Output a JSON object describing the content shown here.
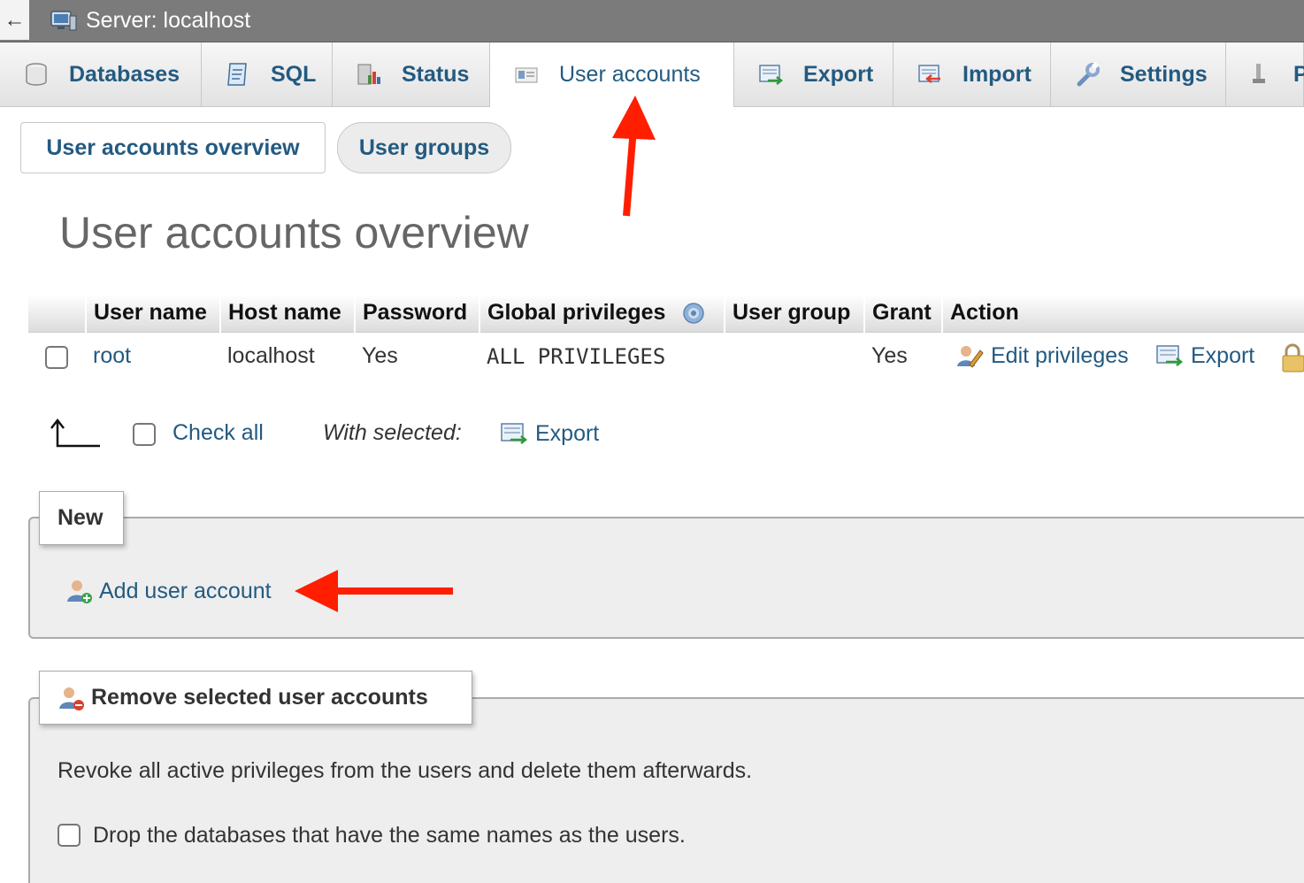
{
  "titlebar": {
    "back_glyph": "←",
    "title": "Server: localhost",
    "icon": "server-icon"
  },
  "tabs": [
    {
      "label": "Databases",
      "icon": "database-icon"
    },
    {
      "label": "SQL",
      "icon": "sql-icon"
    },
    {
      "label": "Status",
      "icon": "status-icon"
    },
    {
      "label": "User accounts",
      "icon": "user-accounts-icon",
      "active": true
    },
    {
      "label": "Export",
      "icon": "export-icon"
    },
    {
      "label": "Import",
      "icon": "import-icon"
    },
    {
      "label": "Settings",
      "icon": "settings-icon"
    },
    {
      "label": "P",
      "icon": "plugins-icon"
    }
  ],
  "subtabs": {
    "overview": "User accounts overview",
    "groups": "User groups"
  },
  "page": {
    "title": "User accounts overview"
  },
  "table": {
    "headers": [
      "User name",
      "Host name",
      "Password",
      "Global privileges",
      "User group",
      "Grant",
      "Action"
    ],
    "rows": [
      {
        "user": "root",
        "host": "localhost",
        "password": "Yes",
        "privileges": "ALL PRIVILEGES",
        "group": "",
        "grant": "Yes",
        "edit_label": "Edit privileges",
        "export_label": "Export"
      }
    ]
  },
  "bulk": {
    "check_all": "Check all",
    "with_selected": "With selected:",
    "export_label": "Export"
  },
  "new_section": {
    "legend": "New",
    "add_label": "Add user account"
  },
  "remove_section": {
    "legend": "Remove selected user accounts",
    "description": "Revoke all active privileges from the users and delete them afterwards.",
    "drop_label": "Drop the databases that have the same names as the users."
  },
  "colors": {
    "link": "#235a81",
    "annotation": "#ff1e00",
    "titlebar": "#7b7b7b"
  }
}
